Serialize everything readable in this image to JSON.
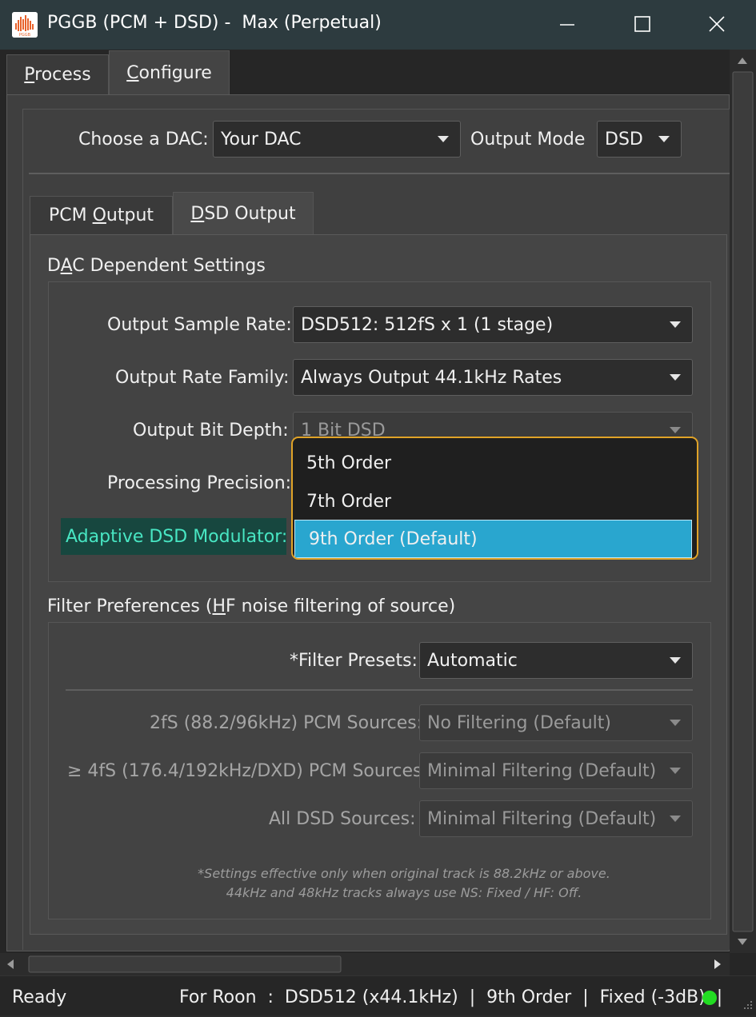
{
  "window": {
    "title": "PGGB (PCM + DSD) -  Max (Perpetual)",
    "icon_caption": "PGGB"
  },
  "top_tabs": [
    {
      "label": "Process",
      "mnemonic": "P",
      "rest": "rocess"
    },
    {
      "label": "Configure",
      "mnemonic": "C",
      "rest": "onfigure"
    }
  ],
  "dac": {
    "label": "Choose a DAC:",
    "value": "Your DAC"
  },
  "output_mode": {
    "label": "Output Mode",
    "value": "DSD"
  },
  "inner_tabs": [
    {
      "label": "PCM Output",
      "pre": "PCM ",
      "mnemonic": "O",
      "rest": "utput"
    },
    {
      "label": "DSD Output",
      "pre": "",
      "mnemonic": "D",
      "rest": "SD Output"
    }
  ],
  "dac_settings": {
    "title_pre": "D",
    "title_mnemonic": "A",
    "title_rest": "C Dependent Settings",
    "sample_rate": {
      "label": "Output Sample Rate:",
      "value": "DSD512: 512fS x 1 (1 stage)"
    },
    "rate_family": {
      "label": "Output Rate Family:",
      "value": "Always Output 44.1kHz Rates"
    },
    "bit_depth": {
      "label": "Output Bit Depth:",
      "value": "1 Bit DSD"
    },
    "precision": {
      "label": "Processing Precision:"
    },
    "modulator": {
      "label": "Adaptive DSD Modulator:"
    }
  },
  "dropdown": {
    "options": [
      "5th Order",
      "7th Order",
      "9th Order (Default)"
    ],
    "selected_index": 2
  },
  "filter_prefs": {
    "title_pre": "Filter Preferences (",
    "title_mnemonic": "H",
    "title_rest": "F noise filtering of source)",
    "presets": {
      "label": "*Filter Presets:",
      "value": "Automatic"
    },
    "pcm_2fs": {
      "label": "2fS (88.2/96kHz) PCM Sources:",
      "value": "No Filtering (Default)"
    },
    "pcm_4fs": {
      "label": "≥ 4fS (176.4/192kHz/DXD) PCM Sources:",
      "value": "Minimal Filtering (Default)"
    },
    "dsd_all": {
      "label": "All DSD Sources:",
      "value": "Minimal Filtering (Default)"
    },
    "note_line1": "*Settings effective only when original track is 88.2kHz or above.",
    "note_line2": "44kHz and 48kHz tracks always use NS: Fixed / HF: Off."
  },
  "status": {
    "ready": "Ready",
    "target": "For Roon  :  DSD512 (x44.1kHz)  |  9th Order  |  Fixed (-3dB)  |",
    "indicator_color": "#22dd22"
  },
  "colors": {
    "titlebar": "#2d3b3f",
    "dropdown_border": "#e0a327",
    "selection": "#29a6cf",
    "highlight_label_bg": "#17473f",
    "highlight_label_text": "#48e6c3"
  }
}
